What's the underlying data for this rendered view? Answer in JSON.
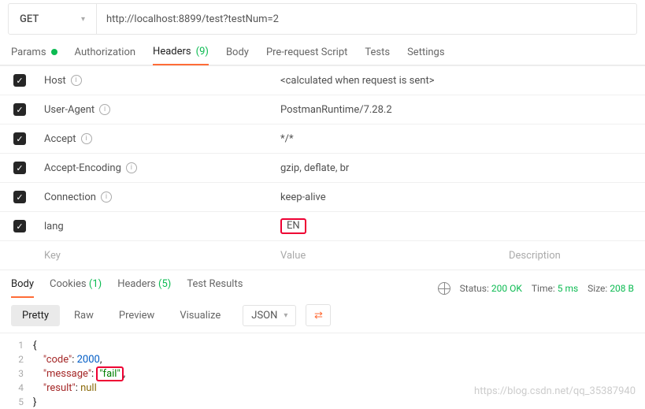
{
  "request": {
    "method": "GET",
    "url": "http://localhost:8899/test?testNum=2"
  },
  "reqTabs": {
    "params": "Params",
    "auth": "Authorization",
    "headers": "Headers",
    "headersCount": "(9)",
    "body": "Body",
    "prereq": "Pre-request Script",
    "tests": "Tests",
    "settings": "Settings"
  },
  "headers": [
    {
      "key": "Host",
      "info": true,
      "value": "<calculated when request is sent>"
    },
    {
      "key": "User-Agent",
      "info": true,
      "value": "PostmanRuntime/7.28.2"
    },
    {
      "key": "Accept",
      "info": true,
      "value": "*/*"
    },
    {
      "key": "Accept-Encoding",
      "info": true,
      "value": "gzip, deflate, br"
    },
    {
      "key": "Connection",
      "info": true,
      "value": "keep-alive"
    },
    {
      "key": "lang",
      "info": false,
      "value": "EN",
      "highlight": true
    }
  ],
  "headerPlaceholders": {
    "key": "Key",
    "value": "Value",
    "desc": "Description"
  },
  "respTabs": {
    "body": "Body",
    "cookies": "Cookies",
    "cookiesCount": "(1)",
    "headers": "Headers",
    "headersCount": "(5)",
    "tests": "Test Results"
  },
  "status": {
    "statusLabel": "Status:",
    "statusVal": "200 OK",
    "timeLabel": "Time:",
    "timeVal": "5 ms",
    "sizeLabel": "Size:",
    "sizeVal": "208 B"
  },
  "viewModes": {
    "pretty": "Pretty",
    "raw": "Raw",
    "preview": "Preview",
    "viz": "Visualize",
    "fmt": "JSON"
  },
  "responseBody": {
    "code": 2000,
    "message": "fail",
    "result": null
  },
  "watermark": "https://blog.csdn.net/qq_35387940"
}
